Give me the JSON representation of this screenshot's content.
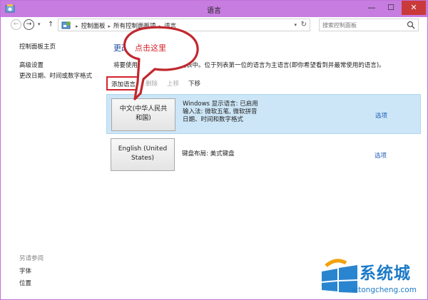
{
  "window": {
    "title": "语言",
    "minimize_glyph": "—",
    "maximize_glyph": "☐",
    "close_glyph": "✕"
  },
  "address": {
    "crumbs": [
      "控制面板",
      "所有控制面板项",
      "语言"
    ],
    "search_placeholder": "搜索控制面板"
  },
  "sidebar": {
    "links": [
      "控制面板主页",
      "高级设置",
      "更改日期、时间或数字格式"
    ],
    "see_also_heading": "另请参阅",
    "see_also_links": [
      "字体",
      "位置"
    ]
  },
  "main": {
    "heading": "更改语言首选项",
    "description": "将要使用的语言添加到此列表中。位于列表第一位的语言为主语言(即你希望看到并最常使用的语言)。",
    "toolbar": {
      "add": "添加语言",
      "remove": "删除",
      "move_up": "上移",
      "move_down": "下移"
    },
    "languages": [
      {
        "name_line1": "中文(中华人民共",
        "name_line2": "和国)",
        "info": [
          "Windows 显示语言: 已启用",
          "输入法: 微软五笔, 微软拼音",
          "日期、时间和数字格式"
        ],
        "options": "选项",
        "selected": true
      },
      {
        "name_line1": "English (United",
        "name_line2": "States)",
        "info": [
          "键盘布局: 美式键盘"
        ],
        "options": "选项",
        "selected": false
      }
    ]
  },
  "annotation": {
    "text": "点击这里",
    "color": "#d3242c"
  },
  "watermark": {
    "brand": "系统城",
    "url": "xitongcheng.com",
    "color": "#1b7ac8"
  },
  "colors": {
    "titlebar": "#c77de0",
    "selection": "#cde6f7",
    "link": "#1f5fb8"
  }
}
